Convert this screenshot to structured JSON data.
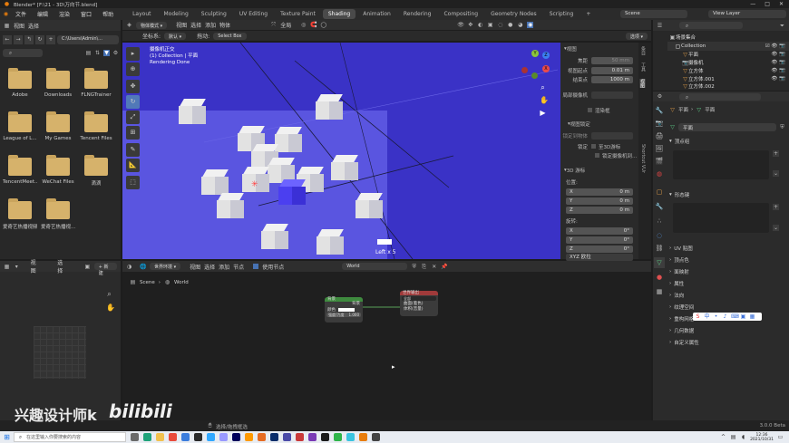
{
  "window": {
    "title": "Blender* [F:\\21 - 3D\\万向节.blend]",
    "controls": [
      "—",
      "□",
      "✕"
    ]
  },
  "topbar": {
    "menus": [
      "文件",
      "编辑",
      "渲染",
      "窗口",
      "帮助"
    ],
    "workspaces": [
      "Layout",
      "Modeling",
      "Sculpting",
      "UV Editing",
      "Texture Paint",
      "Shading",
      "Animation",
      "Rendering",
      "Compositing",
      "Geometry Nodes",
      "Scripting",
      "+"
    ],
    "active_workspace": "Shading",
    "scene": "Scene",
    "view_layer": "View Layer"
  },
  "file_browser": {
    "menus": [
      "视图",
      "选择"
    ],
    "path": "C:\\Users\\Admin\\...",
    "folders": [
      "Adobe",
      "Downloads",
      "FLNGTrainer",
      "League of L...",
      "My Games",
      "Tencent Files",
      "TencentMeet...",
      "WeChat Files",
      "滴滴",
      "爱奇艺热播视频",
      "爱奇艺热播视..."
    ]
  },
  "viewport": {
    "header": {
      "mode": "物体模式",
      "menus": [
        "视图",
        "选择",
        "添加",
        "物体"
      ],
      "shading": "全局",
      "coordinate_label": "坐标系:",
      "coordinate_value": "默认",
      "drag_label": "拖动:",
      "drag_value": "Select Box",
      "options": "选项"
    },
    "overlay_text": [
      "摄像机正交",
      "(1) Collection | 平面",
      "Rendering Done"
    ],
    "status": "Left x 5",
    "gizmo": {
      "x": "X",
      "y": "Y",
      "z": "Z"
    }
  },
  "npanel": {
    "section_view": "视图",
    "focal_label": "焦距",
    "focal_value": "50 mm",
    "clip_start_label": "视图起点",
    "clip_start_value": "0.01 m",
    "clip_end_label": "结束点",
    "clip_end_value": "1000 m",
    "local_camera_label": "局部摄像机",
    "render_region": "渲染框",
    "section_view_lock": "视图锁定",
    "lock_object_label": "锁定到物体",
    "lock_label": "锁定",
    "lock_to_cursor": "至3D游标",
    "lock_camera": "锁定摄像机到...",
    "section_cursor": "3D 游标",
    "location_label": "位置:",
    "loc_x": "0 m",
    "loc_y": "0 m",
    "loc_z": "0 m",
    "rotation_label": "旋转:",
    "rot_x": "0°",
    "rot_y": "0°",
    "rot_z": "0°",
    "rotation_mode": "XYZ 欧拉",
    "axis_x": "X",
    "axis_y": "Y",
    "axis_z": "Z",
    "tabs": [
      "条目",
      "工具",
      "视图",
      "Shortcut VUr"
    ]
  },
  "outliner": {
    "root": "场景集合",
    "collection": "Collection",
    "items": [
      "平面",
      "摄像机",
      "立方体",
      "立方体.001",
      "立方体.002"
    ]
  },
  "properties": {
    "breadcrumb_obj": "平面",
    "breadcrumb_data": "平面",
    "datablock": "平面",
    "sections": [
      "顶点组",
      "形态键",
      "UV 贴图",
      "顶点色",
      "面映射",
      "属性",
      "法向",
      "纹理空间",
      "重构网格",
      "几何数据",
      "自定义属性"
    ]
  },
  "node_editor": {
    "left_menus": [
      "视图",
      "选择",
      "+ 新建"
    ],
    "header_mode": "世界环境",
    "menus": [
      "视图",
      "选择",
      "添加",
      "节点"
    ],
    "use_nodes": "使用节点",
    "world": "World",
    "breadcrumb_scene": "Scene",
    "breadcrumb_world": "World",
    "node_background": {
      "title": "背景",
      "out": "背景",
      "color": "颜色",
      "strength": "强度/力度",
      "strength_value": "1.000"
    },
    "node_output": {
      "title": "世界输出",
      "target": "全部",
      "surface": "曲面(着色)",
      "volume": "体积(音量)"
    }
  },
  "statusbar": {
    "hint": "选择/拖拽框选",
    "version": "3.0.0 Beta",
    "watermark": "兴趣设计师k",
    "bilibili": "bilibili"
  },
  "taskbar": {
    "search_placeholder": "在这里输入你要搜索的内容",
    "time": "12:36",
    "date": "2021/10/31"
  },
  "colors": {
    "viewport_bg": "#3a32c6",
    "viewport_region": "#5a55e0",
    "selected_cube": "#4b3ff0",
    "node_header_green": "#3e8a3e",
    "node_header_red": "#a03a3a"
  }
}
